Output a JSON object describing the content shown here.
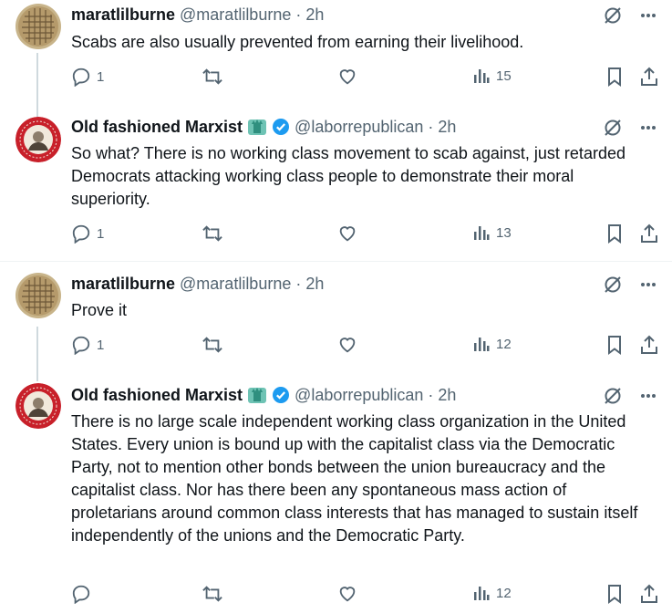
{
  "tweets": [
    {
      "name": "maratlilburne",
      "handle": "@maratlilburne",
      "time": "2h",
      "text": "Scabs are also usually prevented from earning their livelihood.",
      "replies": "1",
      "retweets": "",
      "likes": "",
      "views": "15"
    },
    {
      "name": "Old fashioned Marxist",
      "handle": "@laborrepublican",
      "time": "2h",
      "text": "So what? There is no working class movement to scab against, just retarded Democrats attacking working class people to demonstrate their moral superiority.",
      "replies": "1",
      "retweets": "",
      "likes": "",
      "views": "13"
    },
    {
      "name": "maratlilburne",
      "handle": "@maratlilburne",
      "time": "2h",
      "text": "Prove it",
      "replies": "1",
      "retweets": "",
      "likes": "",
      "views": "12"
    },
    {
      "name": "Old fashioned Marxist",
      "handle": "@laborrepublican",
      "time": "2h",
      "text": "There is no large scale independent working class organization in the United States. Every union is bound up with the capitalist class via the Democratic Party, not to mention other bonds between the union bureaucracy and the capitalist class. Nor has there been any spontaneous mass action of proletarians around common class interests that has managed to sustain itself independently of the unions and the Democratic Party.",
      "replies": "",
      "retweets": "",
      "likes": "",
      "views": "12"
    }
  ],
  "separator": "·",
  "colors": {
    "text": "#0f1419",
    "muted": "#536471",
    "verified": "#1d9bf0",
    "line": "#cfd9de"
  }
}
